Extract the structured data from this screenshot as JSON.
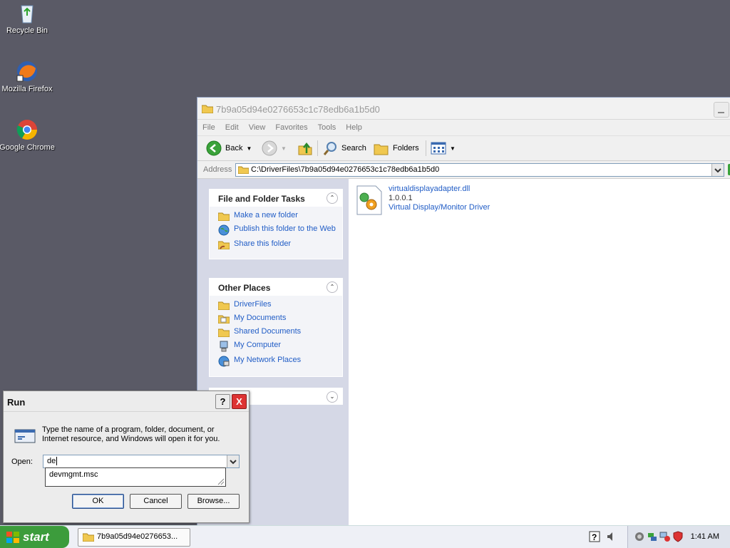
{
  "desktop": {
    "icons": [
      {
        "label": "Recycle Bin"
      },
      {
        "label": "Mozilla Firefox"
      },
      {
        "label": "Google Chrome"
      }
    ]
  },
  "explorer": {
    "title": "7b9a05d94e0276653c1c78edb6a1b5d0",
    "menu": [
      "File",
      "Edit",
      "View",
      "Favorites",
      "Tools",
      "Help"
    ],
    "toolbar": {
      "back": "Back",
      "search": "Search",
      "folders": "Folders"
    },
    "address_label": "Address",
    "address_value": "C:\\DriverFiles\\7b9a05d94e0276653c1c78edb6a1b5d0",
    "file_tasks": {
      "title": "File and Folder Tasks",
      "items": [
        "Make a new folder",
        "Publish this folder to the Web",
        "Share this folder"
      ]
    },
    "other_places": {
      "title": "Other Places",
      "items": [
        "DriverFiles",
        "My Documents",
        "Shared Documents",
        "My Computer",
        "My Network Places"
      ]
    },
    "file": {
      "name": "virtualdisplayadapter.dll",
      "version": "1.0.0.1",
      "description": "Virtual Display/Monitor Driver"
    }
  },
  "run_dialog": {
    "title": "Run",
    "help": "?",
    "close": "X",
    "description": "Type the name of a program, folder, document, or Internet resource, and Windows will open it for you.",
    "open_label": "Open:",
    "open_value": "de",
    "suggestion": "devmgmt.msc",
    "ok": "OK",
    "cancel": "Cancel",
    "browse": "Browse..."
  },
  "taskbar": {
    "start": "start",
    "task_button": "7b9a05d94e0276653...",
    "clock": "1:41 AM"
  }
}
